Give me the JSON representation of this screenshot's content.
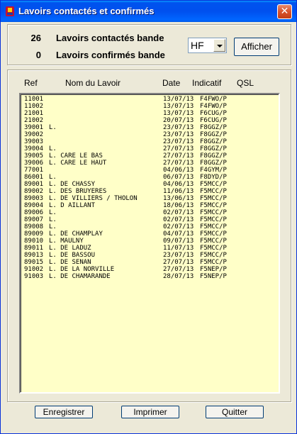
{
  "window": {
    "title": "Lavoirs contactés et confirmés",
    "close_glyph": "✕"
  },
  "summary": {
    "contacted_count": "26",
    "contacted_label": "Lavoirs contactés bande",
    "confirmed_count": "0",
    "confirmed_label": "Lavoirs confirmés bande"
  },
  "band_select": {
    "value": "HF"
  },
  "buttons": {
    "afficher": "Afficher",
    "enregistrer": "Enregistrer",
    "imprimer": "Imprimer",
    "quitter": "Quitter"
  },
  "columns": {
    "ref": "Ref",
    "nom": "Nom du Lavoir",
    "date": "Date",
    "indicatif": "Indicatif",
    "qsl": "QSL"
  },
  "rows": [
    {
      "ref": "11001",
      "nom": "",
      "date": "13/07/13",
      "indicatif": "F4FWO/P"
    },
    {
      "ref": "11002",
      "nom": "",
      "date": "13/07/13",
      "indicatif": "F4FWO/P"
    },
    {
      "ref": "21001",
      "nom": "",
      "date": "13/07/13",
      "indicatif": "F6CUG/P"
    },
    {
      "ref": "21002",
      "nom": "",
      "date": "20/07/13",
      "indicatif": "F6CUG/P"
    },
    {
      "ref": "39001",
      "nom": "L.",
      "date": "23/07/13",
      "indicatif": "F8GGZ/P"
    },
    {
      "ref": "39002",
      "nom": "",
      "date": "23/07/13",
      "indicatif": "F8GGZ/P"
    },
    {
      "ref": "39003",
      "nom": "",
      "date": "23/07/13",
      "indicatif": "F8GGZ/P"
    },
    {
      "ref": "39004",
      "nom": "L.",
      "date": "27/07/13",
      "indicatif": "F8GGZ/P"
    },
    {
      "ref": "39005",
      "nom": "L. CARE LE BAS",
      "date": "27/07/13",
      "indicatif": "F8GGZ/P"
    },
    {
      "ref": "39006",
      "nom": "L. CARE LE HAUT",
      "date": "27/07/13",
      "indicatif": "F8GGZ/P"
    },
    {
      "ref": "77001",
      "nom": "",
      "date": "04/06/13",
      "indicatif": "F4GYM/P"
    },
    {
      "ref": "86001",
      "nom": "L.",
      "date": "06/07/13",
      "indicatif": "F8DYD/P"
    },
    {
      "ref": "89001",
      "nom": "L. DE CHASSY",
      "date": "04/06/13",
      "indicatif": "F5MCC/P"
    },
    {
      "ref": "89002",
      "nom": "L. DES BRUYERES",
      "date": "11/06/13",
      "indicatif": "F5MCC/P"
    },
    {
      "ref": "89003",
      "nom": "L. DE VILLIERS / THOLON",
      "date": "13/06/13",
      "indicatif": "F5MCC/P"
    },
    {
      "ref": "89004",
      "nom": "L. D AILLANT",
      "date": "18/06/13",
      "indicatif": "F5MCC/P"
    },
    {
      "ref": "89006",
      "nom": "L.",
      "date": "02/07/13",
      "indicatif": "F5MCC/P"
    },
    {
      "ref": "89007",
      "nom": "L.",
      "date": "02/07/13",
      "indicatif": "F5MCC/P"
    },
    {
      "ref": "89008",
      "nom": "L.",
      "date": "02/07/13",
      "indicatif": "F5MCC/P"
    },
    {
      "ref": "89009",
      "nom": "L. DE CHAMPLAY",
      "date": "04/07/13",
      "indicatif": "F5MCC/P"
    },
    {
      "ref": "89010",
      "nom": "L. MAULNY",
      "date": "09/07/13",
      "indicatif": "F5MCC/P"
    },
    {
      "ref": "89011",
      "nom": "L. DE LADUZ",
      "date": "11/07/13",
      "indicatif": "F5MCC/P"
    },
    {
      "ref": "89013",
      "nom": "L. DE BASSOU",
      "date": "23/07/13",
      "indicatif": "F5MCC/P"
    },
    {
      "ref": "89015",
      "nom": "L. DE SENAN",
      "date": "27/07/13",
      "indicatif": "F5MCC/P"
    },
    {
      "ref": "91002",
      "nom": "L. DE LA NORVILLE",
      "date": "27/07/13",
      "indicatif": "F5NEP/P"
    },
    {
      "ref": "91003",
      "nom": "L. DE CHAMARANDE",
      "date": "28/07/13",
      "indicatif": "F5NEP/P"
    }
  ],
  "colors": {
    "list_background": "#ffffc8",
    "title_bar": "#0054e3",
    "close_button": "#d8532c"
  }
}
